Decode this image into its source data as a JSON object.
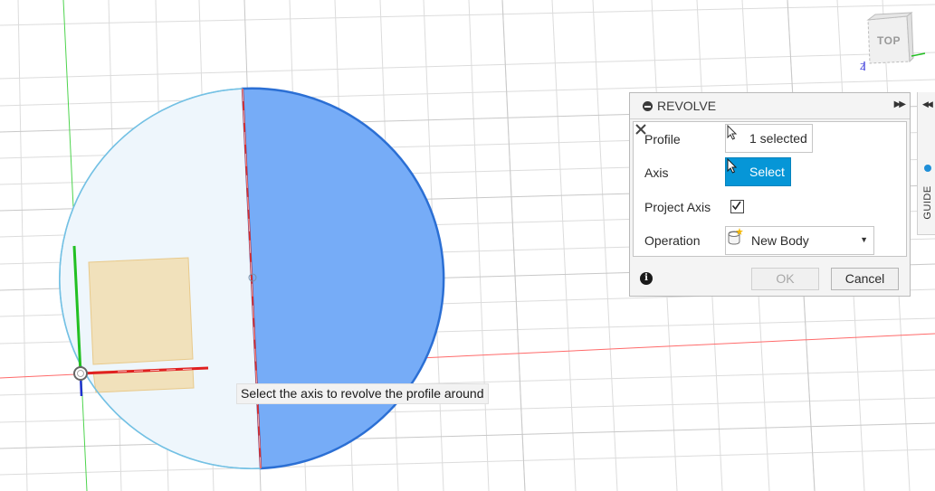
{
  "viewcube": {
    "face_label": "TOP",
    "axis_label": "Z"
  },
  "tooltip": {
    "text": "Select the axis to revolve the profile around"
  },
  "revolve_dialog": {
    "title": "REVOLVE",
    "rows": {
      "profile": {
        "label": "Profile",
        "value": "1 selected"
      },
      "axis": {
        "label": "Axis",
        "value": "Select"
      },
      "project_axis": {
        "label": "Project Axis",
        "checked": true
      },
      "operation": {
        "label": "Operation",
        "value": "New Body"
      }
    },
    "ok_label": "OK",
    "cancel_label": "Cancel"
  },
  "guide_tab": {
    "label": "GUIDE"
  },
  "colors": {
    "accent": "#0696d7",
    "selected_profile": "#6fa8f5",
    "circle_outline": "#6ec3e6",
    "x_axis": "#ff3030",
    "y_axis": "#22c022",
    "sketch_rect": "#f0d9a8"
  }
}
